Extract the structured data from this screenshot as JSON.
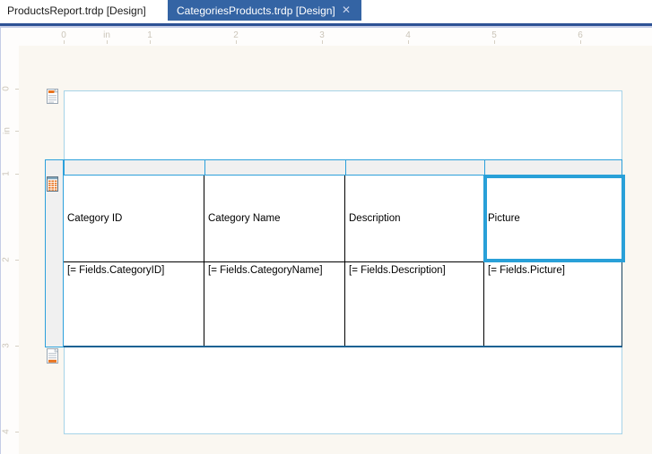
{
  "tabs": [
    {
      "label": "ProductsReport.trdp [Design]",
      "active": false
    },
    {
      "label": "CategoriesProducts.trdp [Design]",
      "active": true,
      "close_glyph": "✕"
    }
  ],
  "ruler": {
    "unit": "in",
    "horizontal": [
      "0",
      "in",
      "1",
      "2",
      "3",
      "4",
      "5",
      "6"
    ],
    "vertical": [
      "0",
      "in",
      "1",
      "2",
      "3",
      "4"
    ]
  },
  "report": {
    "sections": [
      {
        "name": "page-header"
      },
      {
        "name": "detail"
      },
      {
        "name": "page-footer"
      }
    ],
    "table": {
      "header_cells": [
        "Category ID",
        "Category Name",
        "Description",
        "Picture"
      ],
      "data_cells": [
        "[= Fields.CategoryID]",
        "[= Fields.CategoryName]",
        "[= Fields.Description]",
        "[= Fields.Picture]"
      ],
      "selected_cell": "Picture"
    }
  },
  "colors": {
    "active_tab_blue": "#3464A4",
    "tabbar_underline": "#2D5295",
    "band_border_blue": "#2CA0DB",
    "selection_blue": "#29A0D8",
    "table_outline_blue": "#176293",
    "page_border_blue": "#A6D3E8",
    "canvas_cream": "#FAF7F1",
    "band_fill_gray": "#F0F0F0",
    "ruler_text": "#CBC5B9",
    "icon_orange": "#E8731E"
  }
}
